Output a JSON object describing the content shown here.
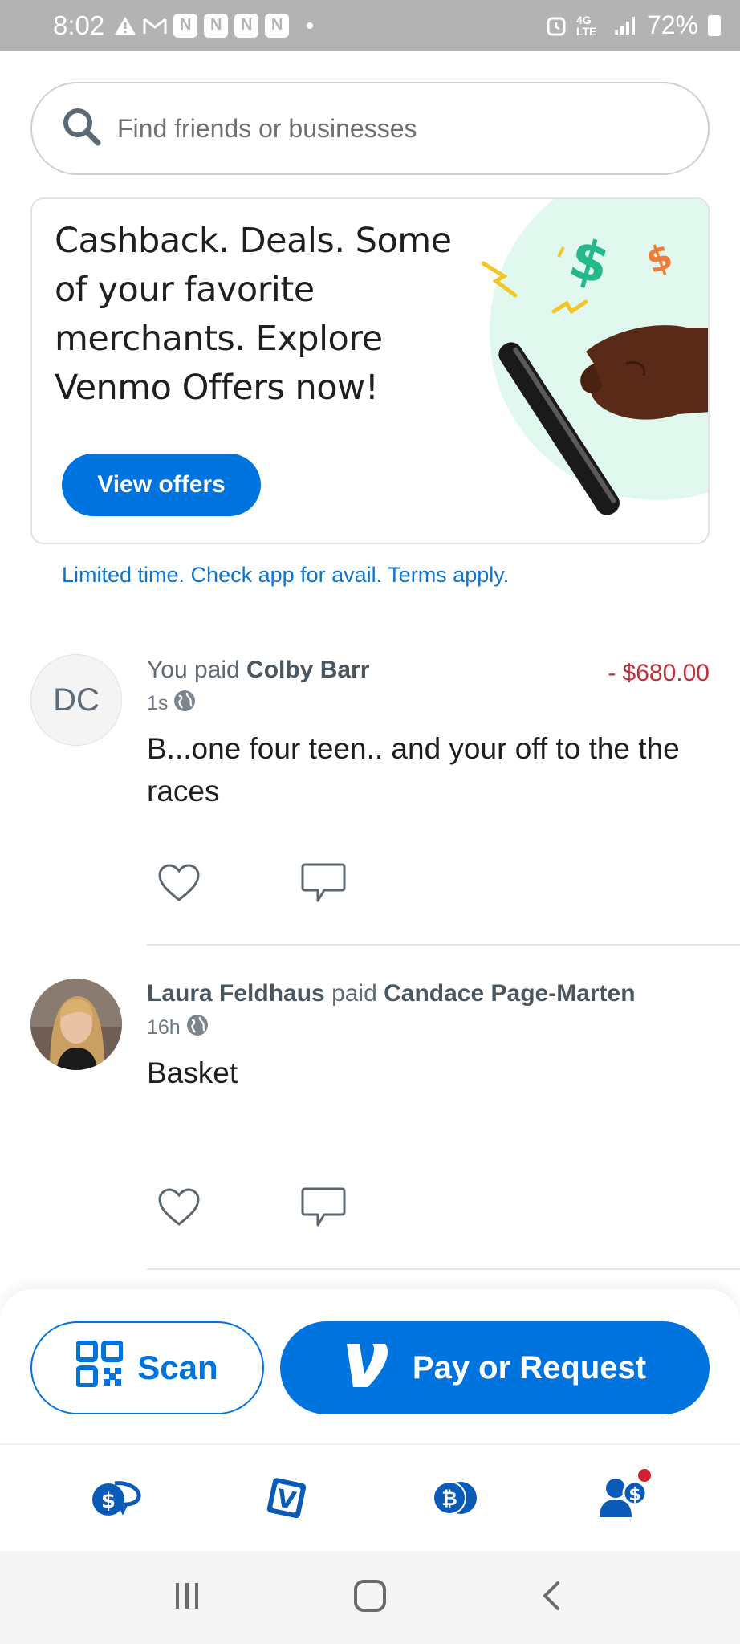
{
  "status_bar": {
    "time": "8:02",
    "battery": "72%",
    "network": "4G LTE"
  },
  "search": {
    "placeholder": "Find friends or businesses"
  },
  "offer_card": {
    "title": "Cashback. Deals. Some of your favorite merchants. Explore Venmo Offers now!",
    "button_label": "View offers",
    "disclaimer": "Limited time. Check app for avail. Terms apply."
  },
  "feed": [
    {
      "initials": "DC",
      "actor": "You",
      "verb": "paid",
      "target": "Colby Barr",
      "amount": "- $680.00",
      "time": "1s",
      "note": "B...one four teen.. and your off to the the races"
    },
    {
      "actor": "Laura Feldhaus",
      "verb": "paid",
      "target": "Candace Page-Marten",
      "time": "16h",
      "note": "Basket"
    }
  ],
  "actions": {
    "scan_label": "Scan",
    "pay_label": "Pay or Request"
  },
  "colors": {
    "brand_blue": "#0074de",
    "debit_red": "#c1313b",
    "notification_red": "#d0202e"
  },
  "tabs": [
    "home-feed-icon",
    "venmo-card-icon",
    "crypto-icon",
    "me-icon"
  ]
}
